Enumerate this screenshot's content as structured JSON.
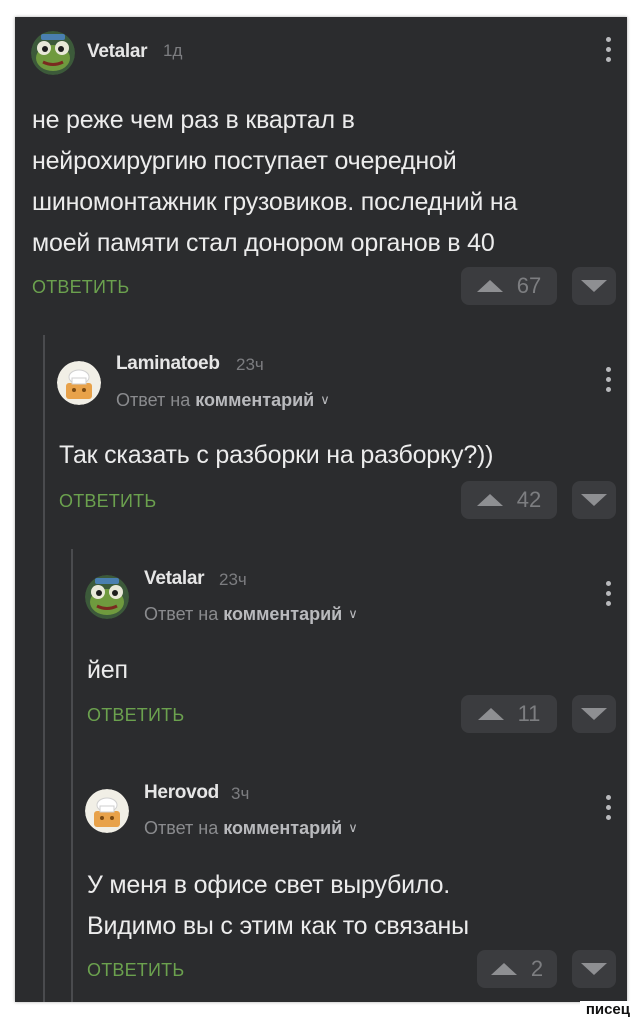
{
  "colors": {
    "background": "#2b2c2e",
    "accent": "#6ba14e",
    "text": "#ececec",
    "muted": "#7c7d80",
    "button_bg": "#3b3c3f"
  },
  "reply_label": "ОТВЕТИТЬ",
  "reply_to_prefix": "Ответ на",
  "reply_to_target": "комментарий",
  "comments": [
    {
      "author": "Vetalar",
      "time": "1д",
      "avatar_icon": "frog-avatar-icon",
      "text_lines": [
        "не реже чем раз в квартал в",
        "нейрохирургию поступает очередной",
        "шиномонтажник грузовиков. последний на",
        "моей памяти стал донором органов в 40"
      ],
      "rating": "67"
    },
    {
      "author": "Laminatoeb",
      "time": "23ч",
      "avatar_icon": "chef-avatar-icon",
      "text_lines": [
        "Так сказать с разборки на разборку?))"
      ],
      "rating": "42"
    },
    {
      "author": "Vetalar",
      "time": "23ч",
      "avatar_icon": "frog-avatar-icon",
      "text_lines": [
        "йеп"
      ],
      "rating": "11"
    },
    {
      "author": "Herovod",
      "time": "3ч",
      "avatar_icon": "chef-avatar-icon",
      "text_lines": [
        "У меня в офисе свет вырубило.",
        "Видимо вы с этим как то связаны"
      ],
      "rating": "2"
    }
  ],
  "watermark": "писец"
}
